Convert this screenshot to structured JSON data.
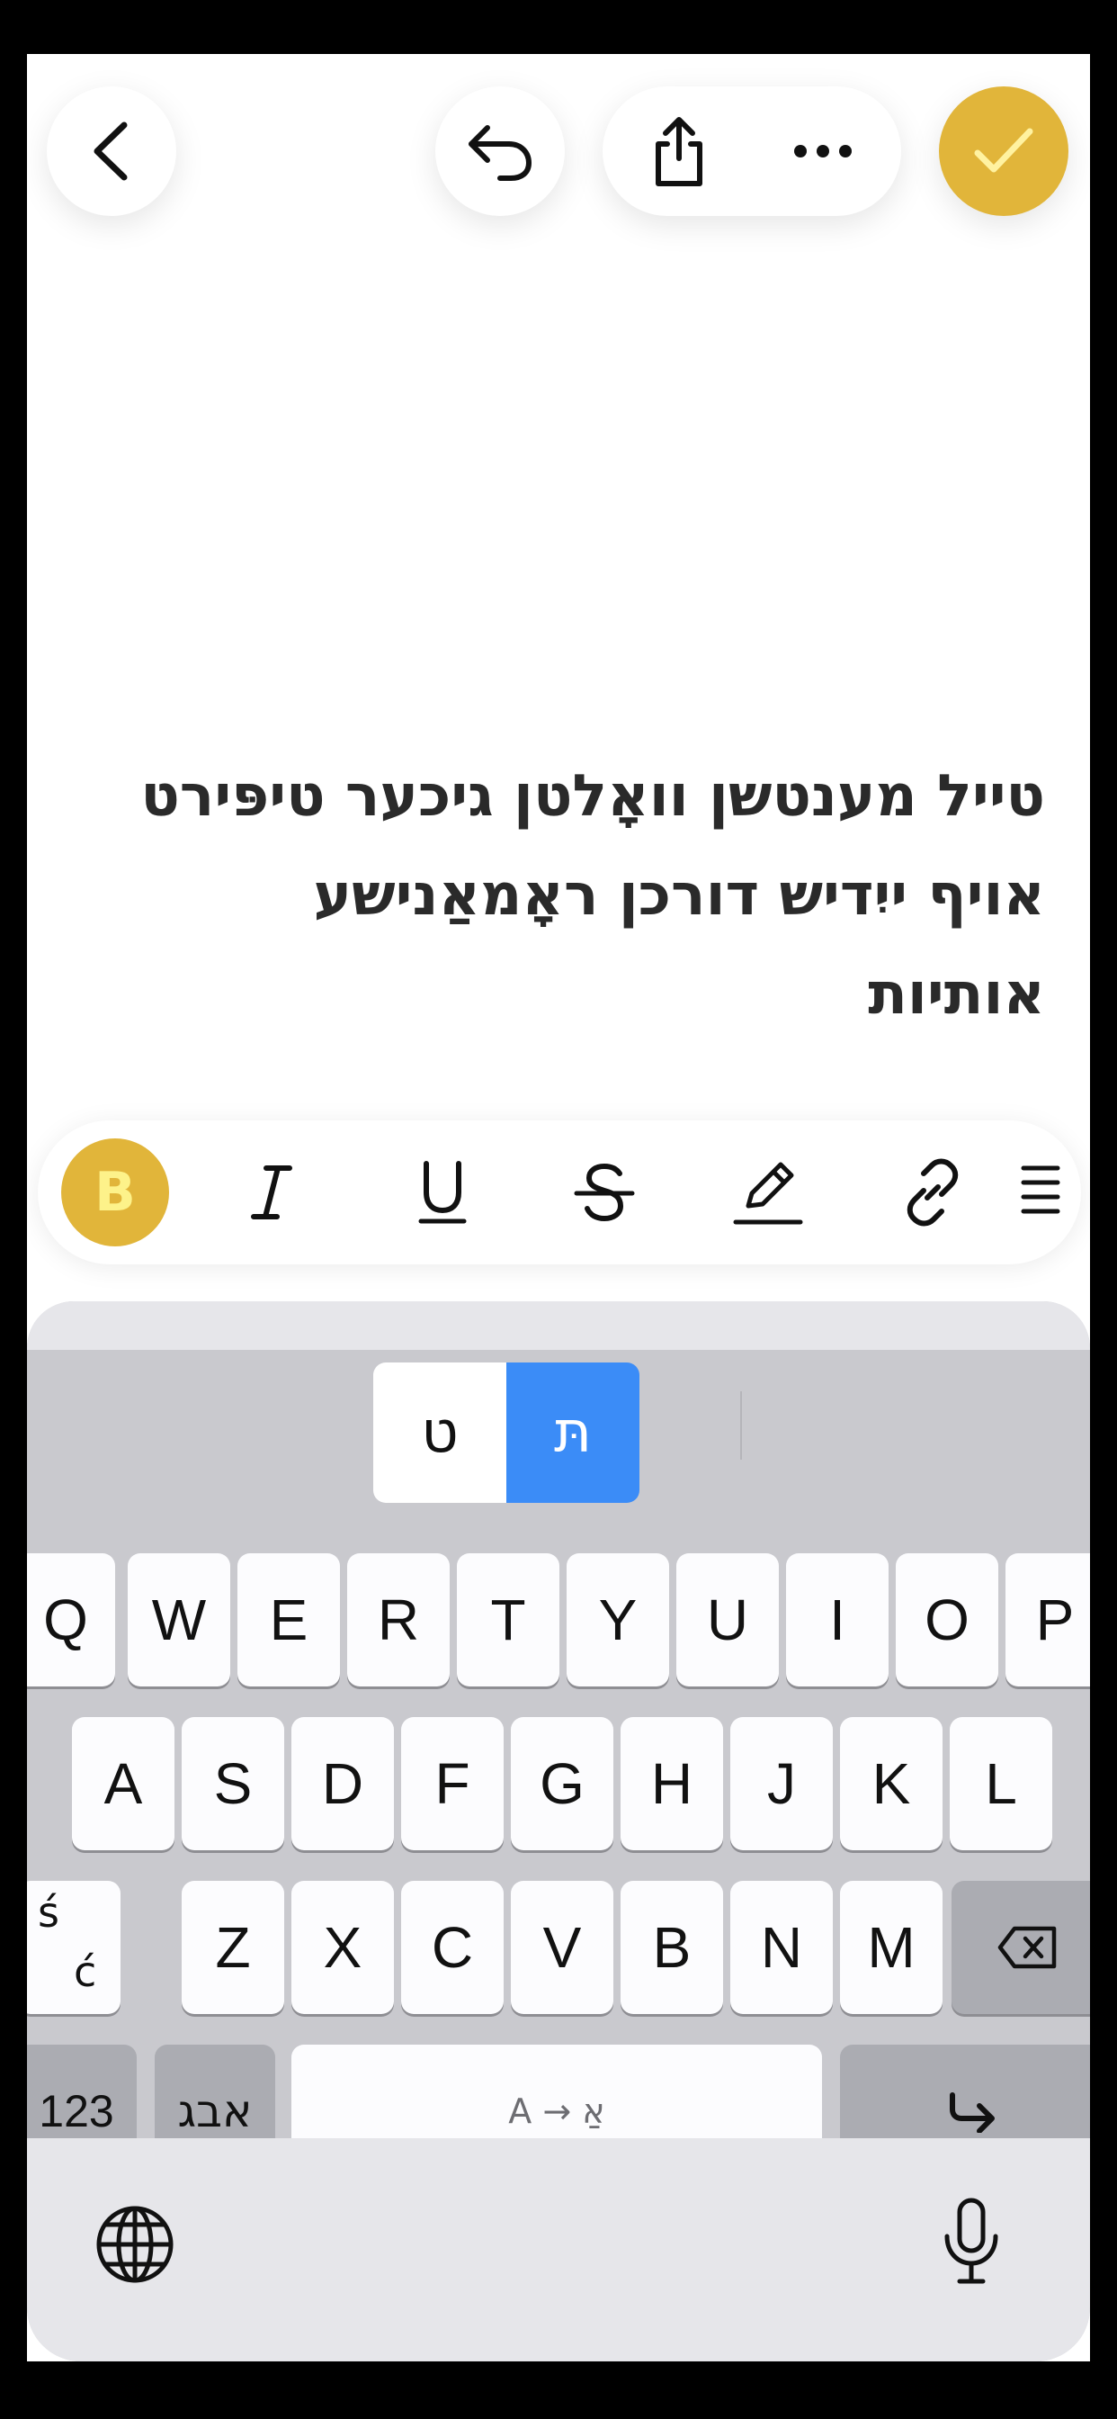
{
  "toolbar": {
    "back_icon": "chevron-left-icon",
    "undo_icon": "undo-arrow-icon",
    "share_icon": "share-icon",
    "more_icon": "ellipsis-icon",
    "done_icon": "checkmark-icon"
  },
  "note": {
    "line1": "טייל מענטשן וואָלטן גיכער טיפּירט",
    "line2": "אויף ייִדיש דורכן ראָמאַנישע",
    "line3": "אותיות"
  },
  "format_bar": {
    "bold_label": "B",
    "italic_icon": "italic-icon",
    "underline_icon": "underline-icon",
    "strikethrough_icon": "strikethrough-icon",
    "highlight_icon": "highlighter-pen-icon",
    "link_icon": "link-icon",
    "align_icon": "align-lines-icon"
  },
  "keyboard": {
    "suggestions": [
      "ט",
      "תּ"
    ],
    "row1": [
      "Q",
      "W",
      "E",
      "R",
      "T",
      "Y",
      "U",
      "I",
      "O",
      "P"
    ],
    "row2": [
      "A",
      "S",
      "D",
      "F",
      "G",
      "H",
      "J",
      "K",
      "L"
    ],
    "accent_key": [
      "ś",
      "ć"
    ],
    "row3": [
      "Z",
      "X",
      "C",
      "V",
      "B",
      "N",
      "M"
    ],
    "numbers_label": "123",
    "hebrew_label": "אבג",
    "space_label": "A → אַ",
    "colors": {
      "accent_yellow": "#e1b53a",
      "suggestion_blue": "#3b8cf7",
      "key_white": "#fcfcfe",
      "key_dark": "#abacb2"
    }
  }
}
